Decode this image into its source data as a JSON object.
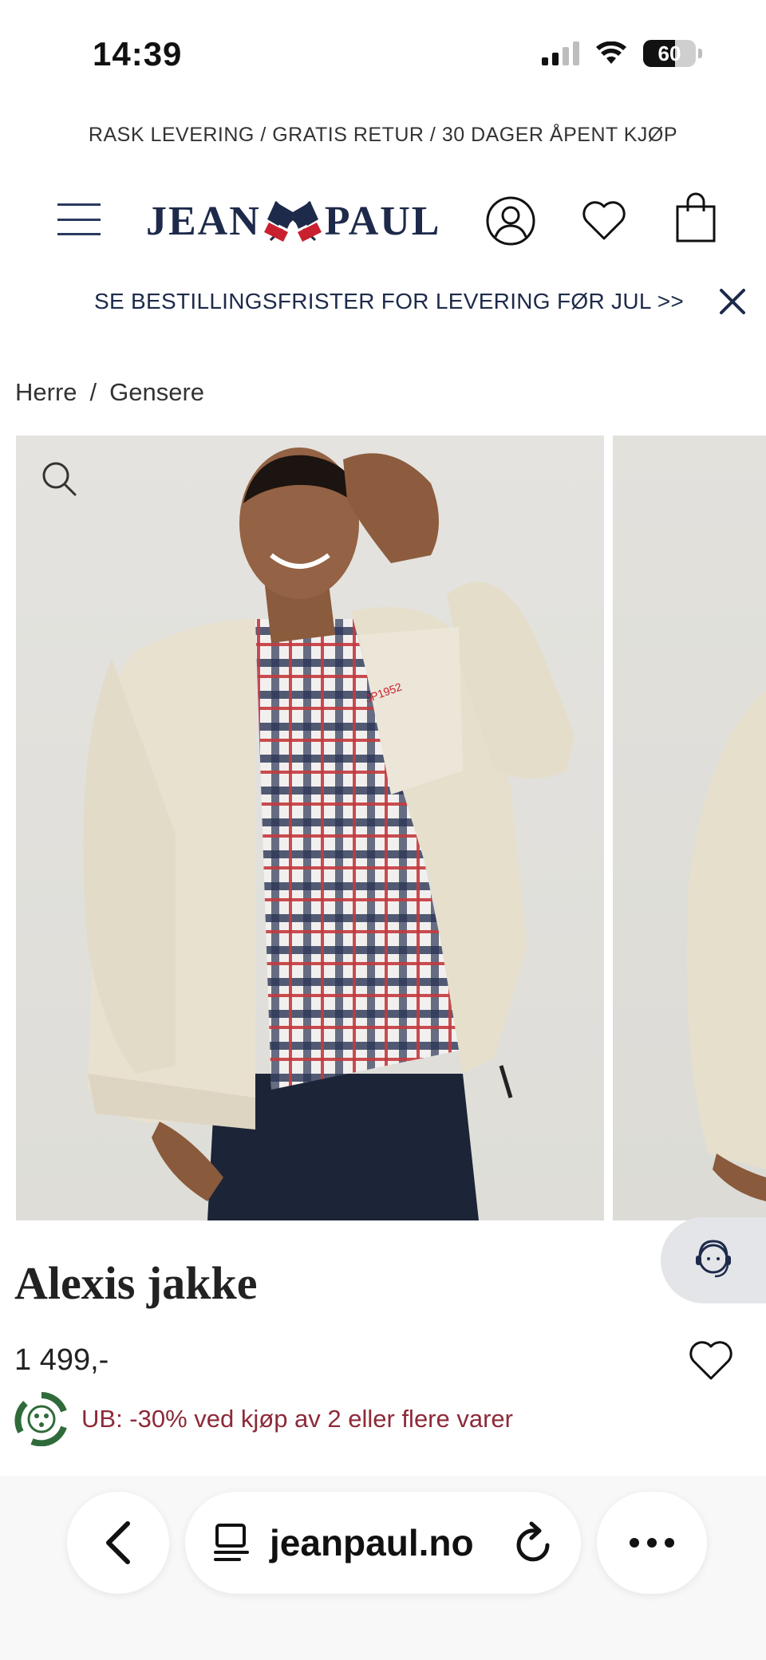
{
  "status_bar": {
    "time": "14:39",
    "battery_level": "60",
    "battery_fraction": 0.6,
    "signal_bars_active": 2,
    "signal_bars_total": 4
  },
  "promo_line": "RASK LEVERING / GRATIS RETUR / 30 DAGER ÅPENT KJØP",
  "header": {
    "logo_left": "JEAN",
    "logo_right": "PAUL"
  },
  "xmas_banner": {
    "text": "SE BESTILLINGSFRISTER FOR LEVERING FØR JUL >>"
  },
  "breadcrumb": {
    "items": [
      "Herre",
      "Gensere"
    ],
    "separator": "/"
  },
  "product": {
    "title": "Alexis jakke",
    "price": "1 499,-",
    "promo": "UB: -30% ved kjøp av 2 eller flere varer",
    "chest_logo_text": "JP1952"
  },
  "browser": {
    "url": "jeanpaul.no"
  },
  "colors": {
    "navy": "#1e2a4a",
    "promo_red": "#8d2a38",
    "promo_green": "#2f6b3a",
    "flag_red": "#c8202f"
  },
  "icons": {
    "menu": "hamburger-icon",
    "account": "user-icon",
    "wishlist": "heart-icon",
    "cart": "shopping-bag-icon",
    "close": "close-icon",
    "zoom": "search-icon",
    "support": "customer-service-icon",
    "back": "chevron-left-icon",
    "reader": "reader-icon",
    "reload": "reload-icon",
    "more": "more-icon"
  }
}
